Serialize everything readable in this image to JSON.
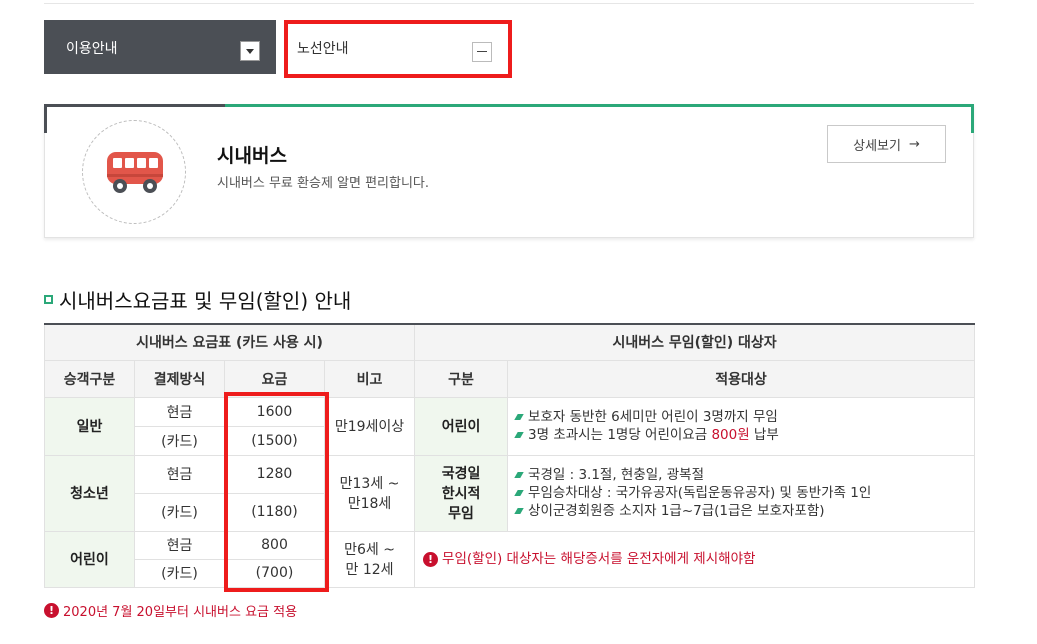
{
  "nav": {
    "primary_label": "이용안내",
    "secondary_label": "노선안내"
  },
  "card": {
    "title": "시내버스",
    "description": "시내버스 무료 환승제 알면 편리합니다.",
    "more_label": "상세보기",
    "arrow": "→"
  },
  "section": {
    "title": "시내버스요금표 및 무임(할인) 안내"
  },
  "table": {
    "header_fare": "시내버스 요금표 (카드 사용 시)",
    "header_free": "시내버스 무임(할인) 대상자",
    "col_passenger": "승객구분",
    "col_payment": "결제방식",
    "col_fare": "요금",
    "col_note": "비고",
    "col_category": "구분",
    "col_target": "적용대상",
    "rows": [
      {
        "type": "일반",
        "cash_label": "현금",
        "cash_fare": "1600",
        "card_label": "(카드)",
        "card_fare": "(1500)",
        "note": "만19세이상"
      },
      {
        "type": "청소년",
        "cash_label": "현금",
        "cash_fare": "1280",
        "card_label": "(카드)",
        "card_fare": "(1180)",
        "note_line1": "만13세 ~",
        "note_line2": "만18세"
      },
      {
        "type": "어린이",
        "cash_label": "현금",
        "cash_fare": "800",
        "card_label": "(카드)",
        "card_fare": "(700)",
        "note_line1": "만6세 ~",
        "note_line2": "만 12세"
      }
    ],
    "free": [
      {
        "category": "어린이",
        "items": [
          {
            "text": "보호자 동반한 6세미만 어린이 3명까지 무임"
          },
          {
            "text_before": "3명 초과시는 1명당 어린이요금 ",
            "text_red": "800원",
            "text_after": " 납부"
          }
        ]
      },
      {
        "category_line1": "국경일",
        "category_line2": "한시적",
        "category_line3": "무임",
        "items": [
          {
            "text": "국경일 : 3.1절, 현충일, 광복절"
          },
          {
            "text": "무임승차대상 : 국가유공자(독립운동유공자) 및 동반가족 1인"
          },
          {
            "text": "상이군경회원증 소지자 1급~7급(1급은 보호자포함)"
          }
        ]
      }
    ],
    "notice": "무임(할인) 대상자는 해당증서를 운전자에게 제시해야함"
  },
  "footer_notice": "2020년 7월 20일부터 시내버스 요금 적용",
  "icons": {
    "alert": "!",
    "bus": "bus-icon"
  },
  "colors": {
    "dark": "#4b4f55",
    "green": "#2ba879",
    "red": "#c8102e",
    "highlight": "#ee1c1c"
  }
}
